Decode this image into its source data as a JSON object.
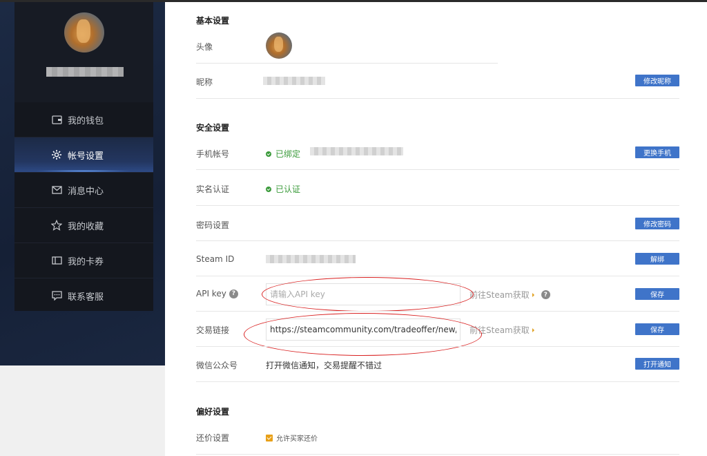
{
  "sidebar": {
    "menu": [
      {
        "label": "我的钱包",
        "icon": "wallet-icon"
      },
      {
        "label": "帐号设置",
        "icon": "gear-icon"
      },
      {
        "label": "消息中心",
        "icon": "mail-icon"
      },
      {
        "label": "我的收藏",
        "icon": "star-icon"
      },
      {
        "label": "我的卡券",
        "icon": "coupon-icon"
      },
      {
        "label": "联系客服",
        "icon": "chat-icon"
      }
    ],
    "active_index": 1
  },
  "basic": {
    "title": "基本设置",
    "avatar_label": "头像",
    "nickname_label": "昵称",
    "nickname_button": "修改昵称"
  },
  "security": {
    "title": "安全设置",
    "phone_label": "手机帐号",
    "phone_status": "已绑定",
    "phone_button": "更换手机",
    "realname_label": "实名认证",
    "realname_status": "已认证",
    "password_label": "密码设置",
    "password_button": "修改密码",
    "steamid_label": "Steam ID",
    "steamid_button": "解绑",
    "apikey_label": "API key",
    "apikey_placeholder": "请输入API key",
    "apikey_link": "前往Steam获取",
    "apikey_button": "保存",
    "trade_label": "交易链接",
    "trade_value": "https://steamcommunity.com/tradeoffer/new/?partner=",
    "trade_link": "前往Steam获取",
    "trade_button": "保存",
    "wechat_label": "微信公众号",
    "wechat_text": "打开微信通知，交易提醒不错过",
    "wechat_button": "打开通知"
  },
  "prefs": {
    "title": "偏好设置",
    "bargain_label": "还价设置",
    "bargain_option": "允许买家还价",
    "bargain_checked": true
  },
  "colors": {
    "accent": "#3f74c9",
    "success": "#3a9a3a",
    "annotation": "#d92020",
    "checkbox": "#e8a018"
  }
}
